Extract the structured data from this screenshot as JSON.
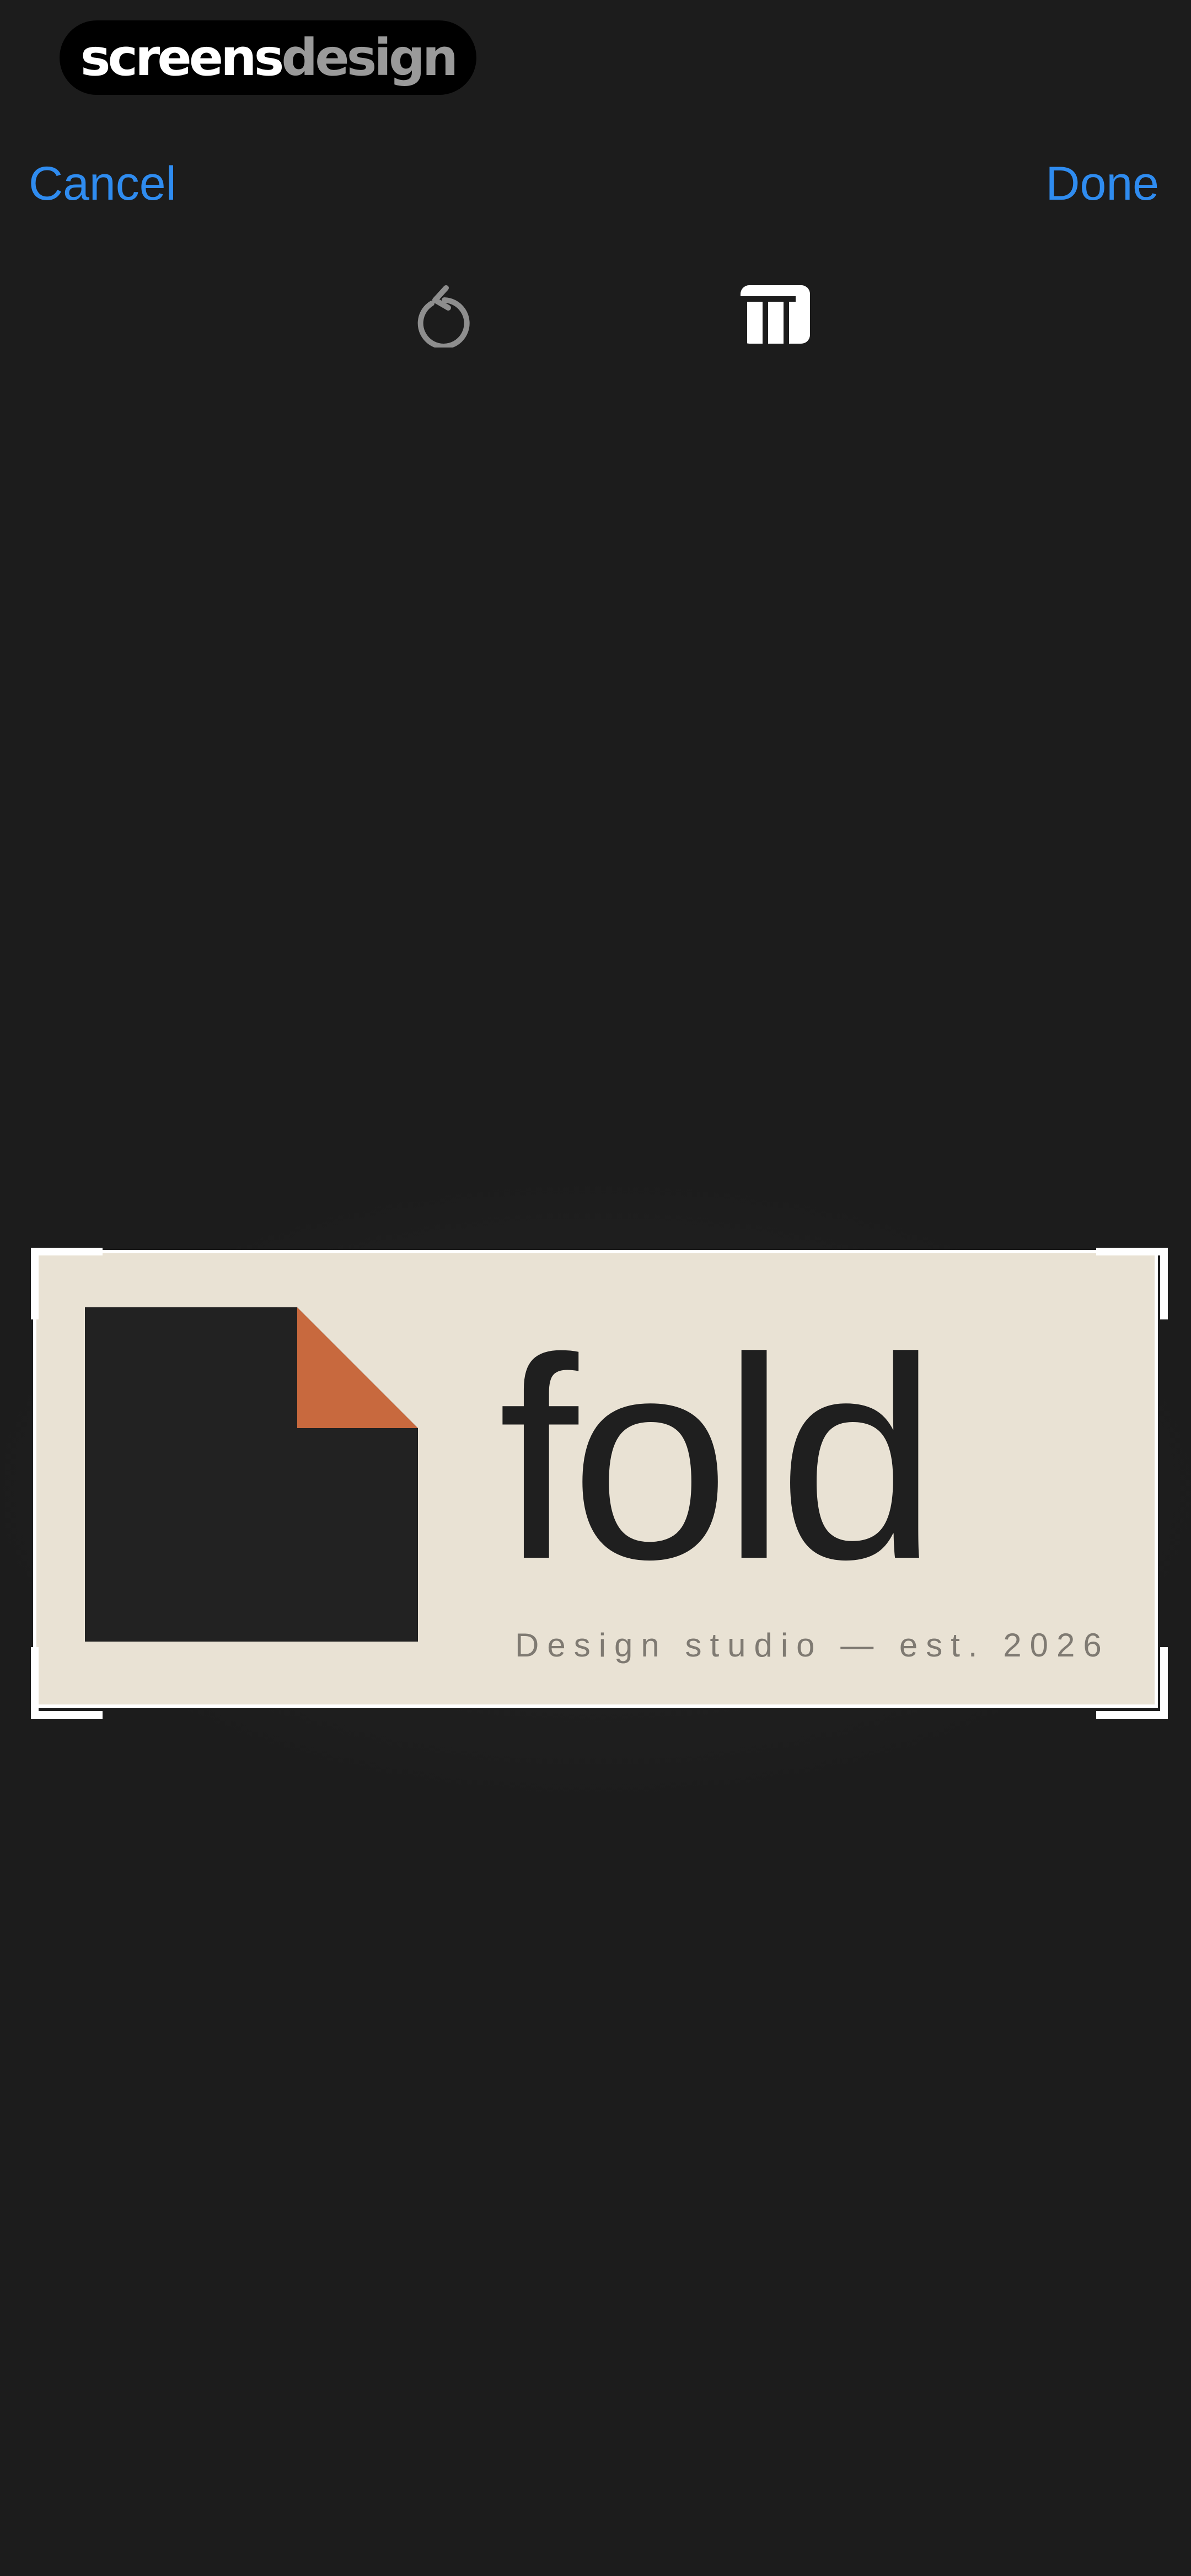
{
  "watermark": {
    "part1": "screens",
    "part2": "design"
  },
  "nav": {
    "cancel_label": "Cancel",
    "done_label": "Done"
  },
  "toolbar": {
    "rotate_icon": "rotate-left-icon",
    "aspect_icon": "aspect-ratio-icon"
  },
  "image": {
    "wordmark": "fold",
    "tagline": "Design studio — est. 2026"
  },
  "colors": {
    "background": "#1c1c1c",
    "accent": "#2f8cf0",
    "logo_cream": "#e9e2d4",
    "logo_dark": "#222222",
    "logo_orange": "#c8693e"
  }
}
